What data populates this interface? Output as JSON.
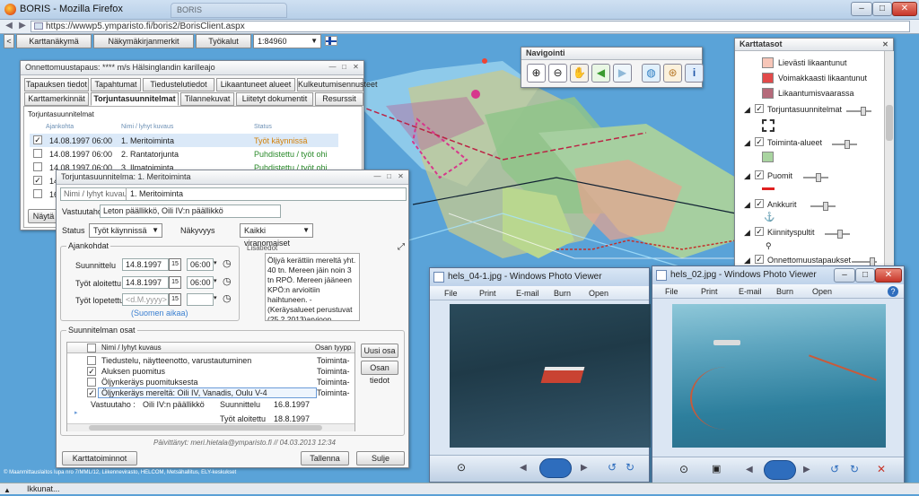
{
  "browser": {
    "title": "BORIS - Mozilla Firefox",
    "tab_title": "BORIS",
    "url": "https://wwwp5.ymparisto.fi/boris2/BorisClient.aspx"
  },
  "toolbar": {
    "map_view": "Karttanäkymä",
    "bookmarks": "Näkymäkirjanmerkit",
    "tools": "Työkalut",
    "scale": "1:84960"
  },
  "navigation": {
    "title": "Navigointi"
  },
  "accident": {
    "title": "Onnettomuustapaus: **** m/s Hälsinglandin karilleajo",
    "tabs_row1": [
      "Tapauksen tiedot",
      "Tapahtumat",
      "Tiedustelutiedot",
      "Likaantuneet alueet",
      "Kulkeutumisennusteet"
    ],
    "tabs_row2": [
      "Karttamerkinnät",
      "Torjuntasuunnitelmat",
      "Tilannekuvat",
      "Liitetyt dokumentit",
      "Resurssit"
    ],
    "section": "Torjuntasuunnitelmat",
    "columns": [
      "Ajankohta",
      "Nimi / lyhyt kuvaus",
      "Status"
    ],
    "rows": [
      {
        "checked": true,
        "date": "14.08.1997 06:00",
        "name": "1. Meritoiminta",
        "status": "Työt käynnissä"
      },
      {
        "checked": false,
        "date": "14.08.1997 06:00",
        "name": "2. Rantatorjunta",
        "status": "Puhdistettu / työt ohi"
      },
      {
        "checked": false,
        "date": "14.08.1997 06:00",
        "name": "3. Ilmatoiminta",
        "status": "Puhdistettu / työt ohi"
      },
      {
        "checked": true,
        "date": "14",
        "name": "",
        "status": ""
      },
      {
        "checked": false,
        "date": "16",
        "name": "",
        "status": ""
      }
    ],
    "show_button": "Näytä t"
  },
  "plan": {
    "title": "Torjuntasuunnitelma: 1. Meritoiminta",
    "name_label": "Nimi / lyhyt kuvaus",
    "name_value": "1. Meritoiminta",
    "responsible_label": "Vastuutaho",
    "responsible_value": "Leton päällikkö, Oili IV:n päällikkö",
    "status_label": "Status",
    "status_value": "Työt käynnissä",
    "visibility_label": "Näkyvyys",
    "visibility_value": "Kaikki viranomaiset",
    "times_legend": "Ajankohdat",
    "planning_label": "Suunnittelu",
    "planning_date": "14.8.1997",
    "planning_time": "06:00",
    "started_label": "Työt aloitettu",
    "started_date": "14.8.1997",
    "started_time": "06:00",
    "ended_label": "Työt lopetettu",
    "ended_placeholder": "<d.M.yyyy>",
    "calendar_day": "15",
    "timezone_link": "(Suomen aikaa)",
    "notes_label": "Lisätiedot",
    "notes_text": "Öljyä kerättiin mereltä yht. 40 tn. Mereen jäin noin 3 tn RPÖ. Mereen jääneen KPÖ:n arvioitiin haihtuneen. - (Keräysalueet perustuvat (25.2.2013)arvioon.",
    "parts_legend": "Suunnitelman osat",
    "parts_columns": [
      "Nimi / lyhyt kuvaus",
      "Osan tyypp"
    ],
    "parts": [
      {
        "checked": false,
        "name": "Tiedustelu, näytteenotto, varustautuminen",
        "type": "Toiminta-"
      },
      {
        "checked": true,
        "name": "Aluksen puomitus",
        "type": "Toiminta-"
      },
      {
        "checked": false,
        "name": "Öljynkeräys puomituksesta",
        "type": "Toiminta-"
      },
      {
        "checked": true,
        "name": "Öljynkeräys mereltä: Oili IV, Vanadis, Oulu V-4",
        "type": "Toiminta-"
      }
    ],
    "detail_resp_label": "Vastuutaho :",
    "detail_resp_value": "Oili IV:n päällikkö",
    "detail_plan_label": "Suunnittelu",
    "detail_plan_value": "16.8.1997",
    "detail_start_label": "Työt aloitettu",
    "detail_start_value": "18.8.1997",
    "new_part": "Uusi osa",
    "part_info": "Osan tiedot",
    "updated": "Päivittänyt: meri.hietala@ymparisto.fi // 04.03.2013 12:34",
    "map_notes_btn": "Karttatoiminnot",
    "save_btn": "Tallenna",
    "close_btn": "Sulje"
  },
  "layers": {
    "title": "Karttatasot",
    "items": [
      {
        "label": "Lievästi likaantunut",
        "color": "#f7c6b8"
      },
      {
        "label": "Voimakkaasti likaantunut",
        "color": "#e24a4a"
      },
      {
        "label": "Likaantumisvaarassa",
        "color": "#b56a7a"
      },
      {
        "label": "Torjuntasuunnitelmat",
        "color": ""
      },
      {
        "label": "Toiminta-alueet",
        "color": "#a9d4a0"
      },
      {
        "label": "Puomit",
        "color": "#e02020"
      },
      {
        "label": "Ankkurit",
        "color": ""
      },
      {
        "label": "Kiinnityspultit",
        "color": ""
      },
      {
        "label": "Onnettomuustapaukset",
        "color": "#c8203a"
      }
    ]
  },
  "viewer1": {
    "title": "hels_04-1.jpg - Windows Photo Viewer",
    "menu": [
      "File",
      "Print",
      "E-mail",
      "Burn",
      "Open"
    ]
  },
  "viewer2": {
    "title": "hels_02.jpg - Windows Photo Viewer",
    "menu": [
      "File",
      "Print",
      "E-mail",
      "Burn",
      "Open"
    ]
  },
  "map_credit": "© Maanmittauslaitos lupa nro 7/MML/12, Liikennevirasto, HELCOM, Metsähallitus, ELY-keskukset",
  "statusbar": {
    "text": "Ikkunat..."
  }
}
